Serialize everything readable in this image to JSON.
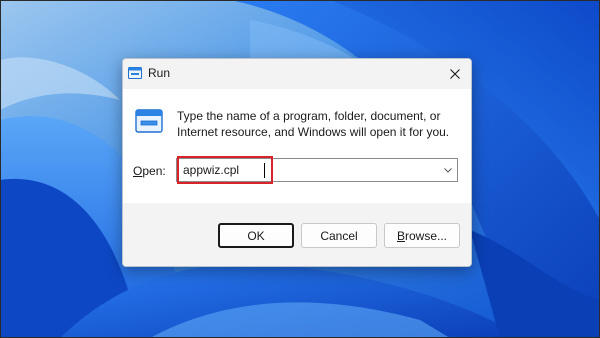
{
  "dialog": {
    "title": "Run",
    "description": "Type the name of a program, folder, document, or Internet resource, and Windows will open it for you.",
    "open_label": "Open:",
    "open_label_accel": "O",
    "open_label_rest": "pen:",
    "command_value": "appwiz.cpl",
    "buttons": {
      "ok": "OK",
      "cancel": "Cancel",
      "browse_accel": "B",
      "browse_rest": "rowse..."
    }
  },
  "icons": {
    "title_icon": "run-icon",
    "content_icon": "run-icon",
    "close": "close-icon",
    "dropdown": "chevron-down-icon"
  },
  "colors": {
    "highlight": "#d9232a",
    "wallpaper_accent": "#1f7fe8"
  }
}
